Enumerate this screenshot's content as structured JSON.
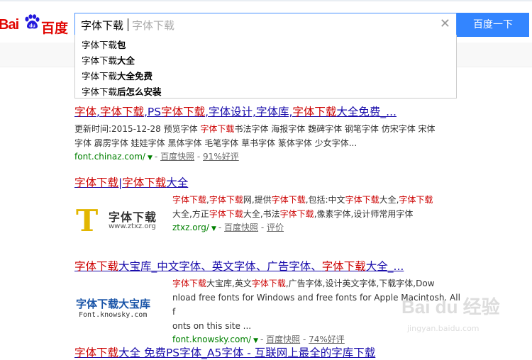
{
  "header": {
    "logo_text_left": "Bai",
    "logo_text_right": "百度",
    "search_query": "字体下载",
    "search_placeholder": "字体下载",
    "search_button": "百度一下"
  },
  "suggestions": [
    {
      "prefix": "字体下载",
      "suffix": "包"
    },
    {
      "prefix": "字体下载",
      "suffix": "大全"
    },
    {
      "prefix": "字体下载",
      "suffix": "大全免费"
    },
    {
      "prefix": "字体下载",
      "suffix": "后怎么安装"
    }
  ],
  "results": [
    {
      "title_parts": [
        "字体",
        ",",
        "字体下载",
        ",PS",
        "字体下载",
        ",字体设计,字体库,",
        "字体下载",
        "大全免费_..."
      ],
      "abstract_line1_parts": [
        "更新时间:2015-12-28 预览字体 ",
        "字体下载",
        "书法字体 海报字体 魏碑字体 钢笔字体 仿宋字体 宋体"
      ],
      "abstract_line2": "字体 霹雳字体 娃娃字体 黑体字体 毛笔字体 草书字体 篆体字体 少女字体...",
      "url": "font.chinaz.com/",
      "snapshot": "百度快照",
      "rating": "91%好评"
    },
    {
      "title_parts": [
        "字体下载",
        "|",
        "字体下载",
        "大全"
      ],
      "abstract_line1_parts": [
        "字体下载",
        ",",
        "字体下载",
        "网,提供",
        "字体下载",
        ",包括:中文",
        "字体下载",
        "大全,",
        "字体下载"
      ],
      "abstract_line2_parts": [
        "大全,方正",
        "字体下载",
        "大全,书法",
        "字体下载",
        ",像素字体,设计师常用字体"
      ],
      "url": "ztxz.org/",
      "snapshot": "百度快照",
      "rating": "评价",
      "thumb_title": "字体下载",
      "thumb_url": "www.ztxz.org",
      "thumb_letter": "T"
    },
    {
      "title_parts": [
        "字体下载",
        "大宝库_中文字体、英文字体、广告字体、",
        "字体下载",
        "大全_..."
      ],
      "abstract_line1_parts": [
        "字体下载",
        "大宝库,英文",
        "字体下载",
        ",广告字体,设计英文字体,下载字体,Dow"
      ],
      "abstract_line2": "nload free fonts for Windows and free fonts for Apple Macintosh. All f",
      "abstract_line3": "onts on this site ...",
      "url": "font.knowsky.com/",
      "snapshot": "百度快照",
      "rating": "74%好评",
      "thumb_title": "字体下载大宝库",
      "thumb_url": "Font.knowsky.com"
    },
    {
      "title_parts": [
        "字体下载",
        "大全 免费PS字体_A5字体 - 互联网上最全的字库下载"
      ]
    }
  ],
  "watermark": {
    "main": "Bai du 经验",
    "sub": "jingyan.baidu.com"
  },
  "colors": {
    "accent": "#3385ff",
    "link": "#1a0dab",
    "highlight": "#cc0000",
    "url_green": "#008000",
    "logo_red": "#e10602"
  }
}
